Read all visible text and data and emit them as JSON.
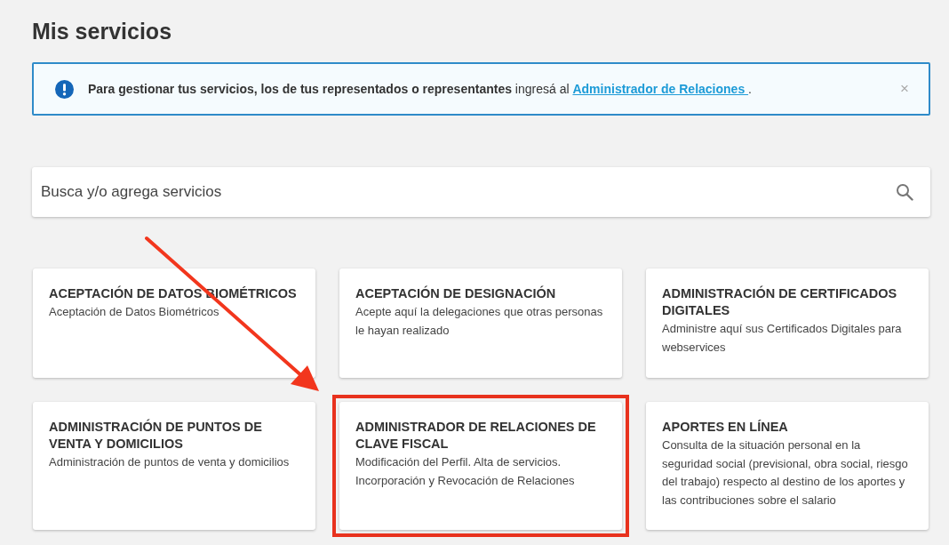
{
  "title": "Mis servicios",
  "alert": {
    "message": "**Para gestionar tus servicios, los de tus representados o representantes** ingresá al",
    "link": "Administrador de Relaciones ",
    "end": ".",
    "close": "×"
  },
  "search": {
    "placeholder": "Busca y/o agrega servicios"
  },
  "services": [
    {
      "name": "ACEPTACIÓN DE DATOS BIOMÉTRICOS",
      "description": "Aceptación de Datos Biométricos",
      "highlighted": false
    },
    {
      "name": "ACEPTACIÓN DE DESIGNACIÓN",
      "description": "Acepte aquí la delegaciones que otras personas le hayan realizado",
      "highlighted": false
    },
    {
      "name": "ADMINISTRACIÓN DE CERTIFICADOS DIGITALES",
      "description": "Administre aquí sus Certificados Digitales para webservices",
      "highlighted": false
    },
    {
      "name": "ADMINISTRACIÓN DE PUNTOS DE VENTA Y DOMICILIOS",
      "description": "Administración de puntos de venta y domicilios",
      "highlighted": false
    },
    {
      "name": "ADMINISTRADOR DE RELACIONES DE CLAVE FISCAL",
      "description": "Modificación del Perfil. Alta de servicios. Incorporación y Revocación de Relaciones",
      "highlighted": true
    },
    {
      "name": "APORTES EN LÍNEA",
      "description": "Consulta de la situación personal en la seguridad social (previsional, obra social, riesgo del trabajo) respecto al destino de los aportes y las contribuciones sobre el salario",
      "highlighted": false
    }
  ]
}
